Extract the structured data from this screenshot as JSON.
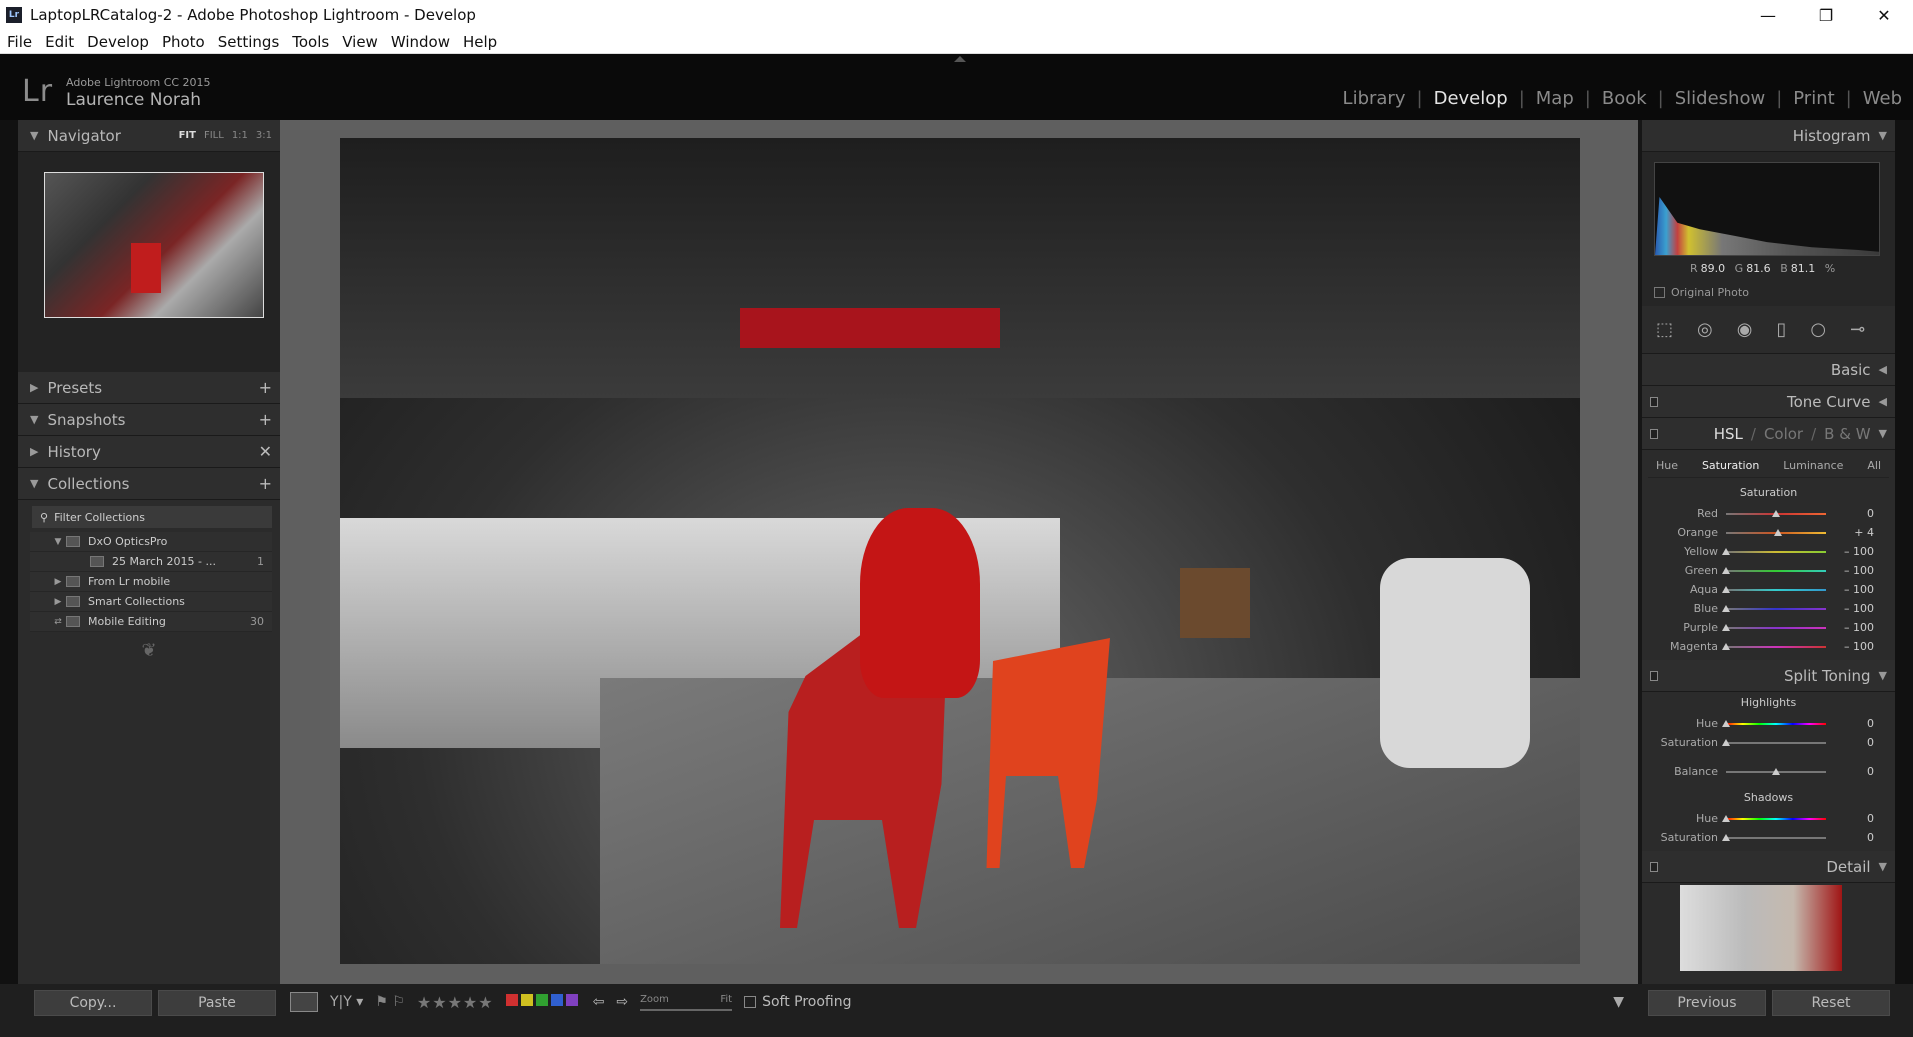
{
  "window": {
    "title": "LaptopLRCatalog-2 - Adobe Photoshop Lightroom - Develop",
    "app_badge": "Lr",
    "minimize": "—",
    "maximize": "❐",
    "close": "✕"
  },
  "menu": [
    "File",
    "Edit",
    "Develop",
    "Photo",
    "Settings",
    "Tools",
    "View",
    "Window",
    "Help"
  ],
  "identity": {
    "logo": "Lr",
    "product": "Adobe Lightroom CC 2015",
    "user": "Laurence Norah"
  },
  "modules": [
    {
      "label": "Library",
      "active": false
    },
    {
      "label": "Develop",
      "active": true
    },
    {
      "label": "Map",
      "active": false
    },
    {
      "label": "Book",
      "active": false
    },
    {
      "label": "Slideshow",
      "active": false
    },
    {
      "label": "Print",
      "active": false
    },
    {
      "label": "Web",
      "active": false
    }
  ],
  "left": {
    "navigator": {
      "title": "Navigator",
      "fit": "FIT",
      "fill": "FILL",
      "one": "1:1",
      "ratio": "3:1"
    },
    "presets": "Presets",
    "snapshots": "Snapshots",
    "history": "History",
    "collections": {
      "title": "Collections",
      "filter": "Filter Collections",
      "items": [
        {
          "name": "DxO OpticsPro",
          "count": "",
          "tri": "▼"
        },
        {
          "name": "25 March 2015 - ...",
          "count": "1",
          "tri": ""
        },
        {
          "name": "From Lr mobile",
          "count": "",
          "tri": "▶"
        },
        {
          "name": "Smart Collections",
          "count": "",
          "tri": "▶"
        },
        {
          "name": "Mobile Editing",
          "count": "30",
          "tri": ""
        }
      ]
    },
    "copy": "Copy...",
    "paste": "Paste"
  },
  "right": {
    "histogram": {
      "title": "Histogram",
      "r_label": "R",
      "r": "89.0",
      "g_label": "G",
      "g": "81.6",
      "b_label": "B",
      "b": "81.1",
      "pct": "%",
      "original": "Original Photo"
    },
    "basic": "Basic",
    "tonecurve": "Tone Curve",
    "hsl": {
      "hsl": "HSL",
      "slash": "/",
      "color": "Color",
      "bw": "B & W",
      "tabs": [
        "Hue",
        "Saturation",
        "Luminance",
        "All"
      ],
      "group": "Saturation",
      "sliders": [
        {
          "label": "Red",
          "value": "0",
          "pos": 0.5
        },
        {
          "label": "Orange",
          "value": "+ 4",
          "pos": 0.52
        },
        {
          "label": "Yellow",
          "value": "– 100",
          "pos": 0.0
        },
        {
          "label": "Green",
          "value": "– 100",
          "pos": 0.0
        },
        {
          "label": "Aqua",
          "value": "– 100",
          "pos": 0.0
        },
        {
          "label": "Blue",
          "value": "– 100",
          "pos": 0.0
        },
        {
          "label": "Purple",
          "value": "– 100",
          "pos": 0.0
        },
        {
          "label": "Magenta",
          "value": "– 100",
          "pos": 0.0
        }
      ]
    },
    "split": {
      "title": "Split Toning",
      "highlights": "Highlights",
      "shadows": "Shadows",
      "h_hue": {
        "label": "Hue",
        "value": "0"
      },
      "h_sat": {
        "label": "Saturation",
        "value": "0"
      },
      "balance": {
        "label": "Balance",
        "value": "0"
      },
      "s_hue": {
        "label": "Hue",
        "value": "0"
      },
      "s_sat": {
        "label": "Saturation",
        "value": "0"
      }
    },
    "detail": "Detail",
    "previous": "Previous",
    "reset": "Reset"
  },
  "toolbar": {
    "stars": "★★★★★",
    "zoom": "Zoom",
    "fit": "Fit",
    "soft_proofing": "Soft Proofing",
    "colors": [
      "#d03030",
      "#d0c020",
      "#30a030",
      "#3060d0",
      "#8040c0"
    ]
  }
}
